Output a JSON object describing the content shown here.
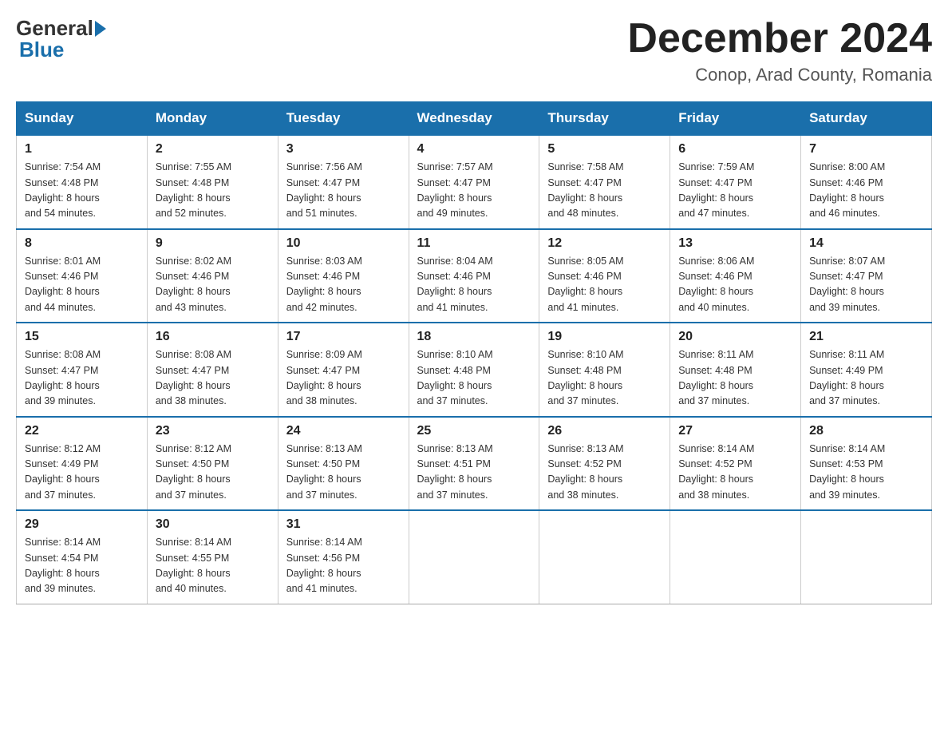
{
  "logo": {
    "general": "General",
    "blue": "Blue"
  },
  "title": "December 2024",
  "location": "Conop, Arad County, Romania",
  "days_of_week": [
    "Sunday",
    "Monday",
    "Tuesday",
    "Wednesday",
    "Thursday",
    "Friday",
    "Saturday"
  ],
  "weeks": [
    [
      {
        "day": "1",
        "sunrise": "7:54 AM",
        "sunset": "4:48 PM",
        "daylight": "8 hours and 54 minutes."
      },
      {
        "day": "2",
        "sunrise": "7:55 AM",
        "sunset": "4:48 PM",
        "daylight": "8 hours and 52 minutes."
      },
      {
        "day": "3",
        "sunrise": "7:56 AM",
        "sunset": "4:47 PM",
        "daylight": "8 hours and 51 minutes."
      },
      {
        "day": "4",
        "sunrise": "7:57 AM",
        "sunset": "4:47 PM",
        "daylight": "8 hours and 49 minutes."
      },
      {
        "day": "5",
        "sunrise": "7:58 AM",
        "sunset": "4:47 PM",
        "daylight": "8 hours and 48 minutes."
      },
      {
        "day": "6",
        "sunrise": "7:59 AM",
        "sunset": "4:47 PM",
        "daylight": "8 hours and 47 minutes."
      },
      {
        "day": "7",
        "sunrise": "8:00 AM",
        "sunset": "4:46 PM",
        "daylight": "8 hours and 46 minutes."
      }
    ],
    [
      {
        "day": "8",
        "sunrise": "8:01 AM",
        "sunset": "4:46 PM",
        "daylight": "8 hours and 44 minutes."
      },
      {
        "day": "9",
        "sunrise": "8:02 AM",
        "sunset": "4:46 PM",
        "daylight": "8 hours and 43 minutes."
      },
      {
        "day": "10",
        "sunrise": "8:03 AM",
        "sunset": "4:46 PM",
        "daylight": "8 hours and 42 minutes."
      },
      {
        "day": "11",
        "sunrise": "8:04 AM",
        "sunset": "4:46 PM",
        "daylight": "8 hours and 41 minutes."
      },
      {
        "day": "12",
        "sunrise": "8:05 AM",
        "sunset": "4:46 PM",
        "daylight": "8 hours and 41 minutes."
      },
      {
        "day": "13",
        "sunrise": "8:06 AM",
        "sunset": "4:46 PM",
        "daylight": "8 hours and 40 minutes."
      },
      {
        "day": "14",
        "sunrise": "8:07 AM",
        "sunset": "4:47 PM",
        "daylight": "8 hours and 39 minutes."
      }
    ],
    [
      {
        "day": "15",
        "sunrise": "8:08 AM",
        "sunset": "4:47 PM",
        "daylight": "8 hours and 39 minutes."
      },
      {
        "day": "16",
        "sunrise": "8:08 AM",
        "sunset": "4:47 PM",
        "daylight": "8 hours and 38 minutes."
      },
      {
        "day": "17",
        "sunrise": "8:09 AM",
        "sunset": "4:47 PM",
        "daylight": "8 hours and 38 minutes."
      },
      {
        "day": "18",
        "sunrise": "8:10 AM",
        "sunset": "4:48 PM",
        "daylight": "8 hours and 37 minutes."
      },
      {
        "day": "19",
        "sunrise": "8:10 AM",
        "sunset": "4:48 PM",
        "daylight": "8 hours and 37 minutes."
      },
      {
        "day": "20",
        "sunrise": "8:11 AM",
        "sunset": "4:48 PM",
        "daylight": "8 hours and 37 minutes."
      },
      {
        "day": "21",
        "sunrise": "8:11 AM",
        "sunset": "4:49 PM",
        "daylight": "8 hours and 37 minutes."
      }
    ],
    [
      {
        "day": "22",
        "sunrise": "8:12 AM",
        "sunset": "4:49 PM",
        "daylight": "8 hours and 37 minutes."
      },
      {
        "day": "23",
        "sunrise": "8:12 AM",
        "sunset": "4:50 PM",
        "daylight": "8 hours and 37 minutes."
      },
      {
        "day": "24",
        "sunrise": "8:13 AM",
        "sunset": "4:50 PM",
        "daylight": "8 hours and 37 minutes."
      },
      {
        "day": "25",
        "sunrise": "8:13 AM",
        "sunset": "4:51 PM",
        "daylight": "8 hours and 37 minutes."
      },
      {
        "day": "26",
        "sunrise": "8:13 AM",
        "sunset": "4:52 PM",
        "daylight": "8 hours and 38 minutes."
      },
      {
        "day": "27",
        "sunrise": "8:14 AM",
        "sunset": "4:52 PM",
        "daylight": "8 hours and 38 minutes."
      },
      {
        "day": "28",
        "sunrise": "8:14 AM",
        "sunset": "4:53 PM",
        "daylight": "8 hours and 39 minutes."
      }
    ],
    [
      {
        "day": "29",
        "sunrise": "8:14 AM",
        "sunset": "4:54 PM",
        "daylight": "8 hours and 39 minutes."
      },
      {
        "day": "30",
        "sunrise": "8:14 AM",
        "sunset": "4:55 PM",
        "daylight": "8 hours and 40 minutes."
      },
      {
        "day": "31",
        "sunrise": "8:14 AM",
        "sunset": "4:56 PM",
        "daylight": "8 hours and 41 minutes."
      },
      null,
      null,
      null,
      null
    ]
  ],
  "labels": {
    "sunrise": "Sunrise:",
    "sunset": "Sunset:",
    "daylight": "Daylight:"
  }
}
